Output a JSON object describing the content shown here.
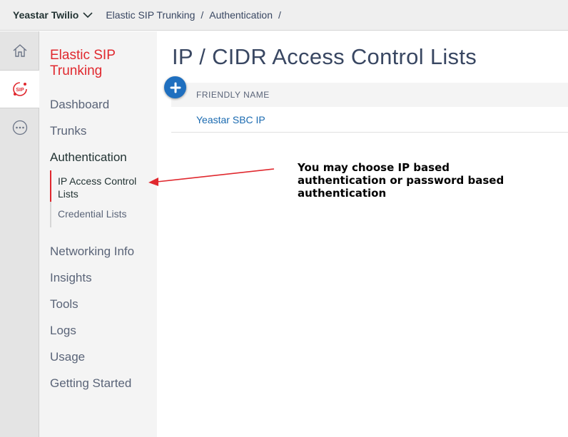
{
  "topbar": {
    "account": "Yeastar Twilio",
    "breadcrumb": [
      "Elastic SIP Trunking",
      "Authentication"
    ],
    "separator": "/"
  },
  "rail": {
    "items": [
      {
        "icon": "home-icon",
        "active": false
      },
      {
        "icon": "sip-icon",
        "label": "SIP",
        "active": true
      },
      {
        "icon": "more-icon",
        "active": false
      }
    ]
  },
  "nav": {
    "section_title": "Elastic SIP Trunking",
    "items": [
      "Dashboard",
      "Trunks",
      "Authentication"
    ],
    "sub_items": [
      "IP Access Control Lists",
      "Credential Lists"
    ],
    "more_items": [
      "Networking Info",
      "Insights",
      "Tools",
      "Logs",
      "Usage",
      "Getting Started"
    ]
  },
  "main": {
    "title": "IP / CIDR Access Control Lists",
    "table": {
      "header": "FRIENDLY NAME",
      "rows": [
        "Yeastar SBC IP"
      ]
    }
  },
  "annotation": {
    "text": "You may choose IP based authentication or password based authentication"
  },
  "colors": {
    "accent_red": "#e0282e",
    "link_blue": "#1a6ab0",
    "button_blue": "#1f6fbf"
  }
}
